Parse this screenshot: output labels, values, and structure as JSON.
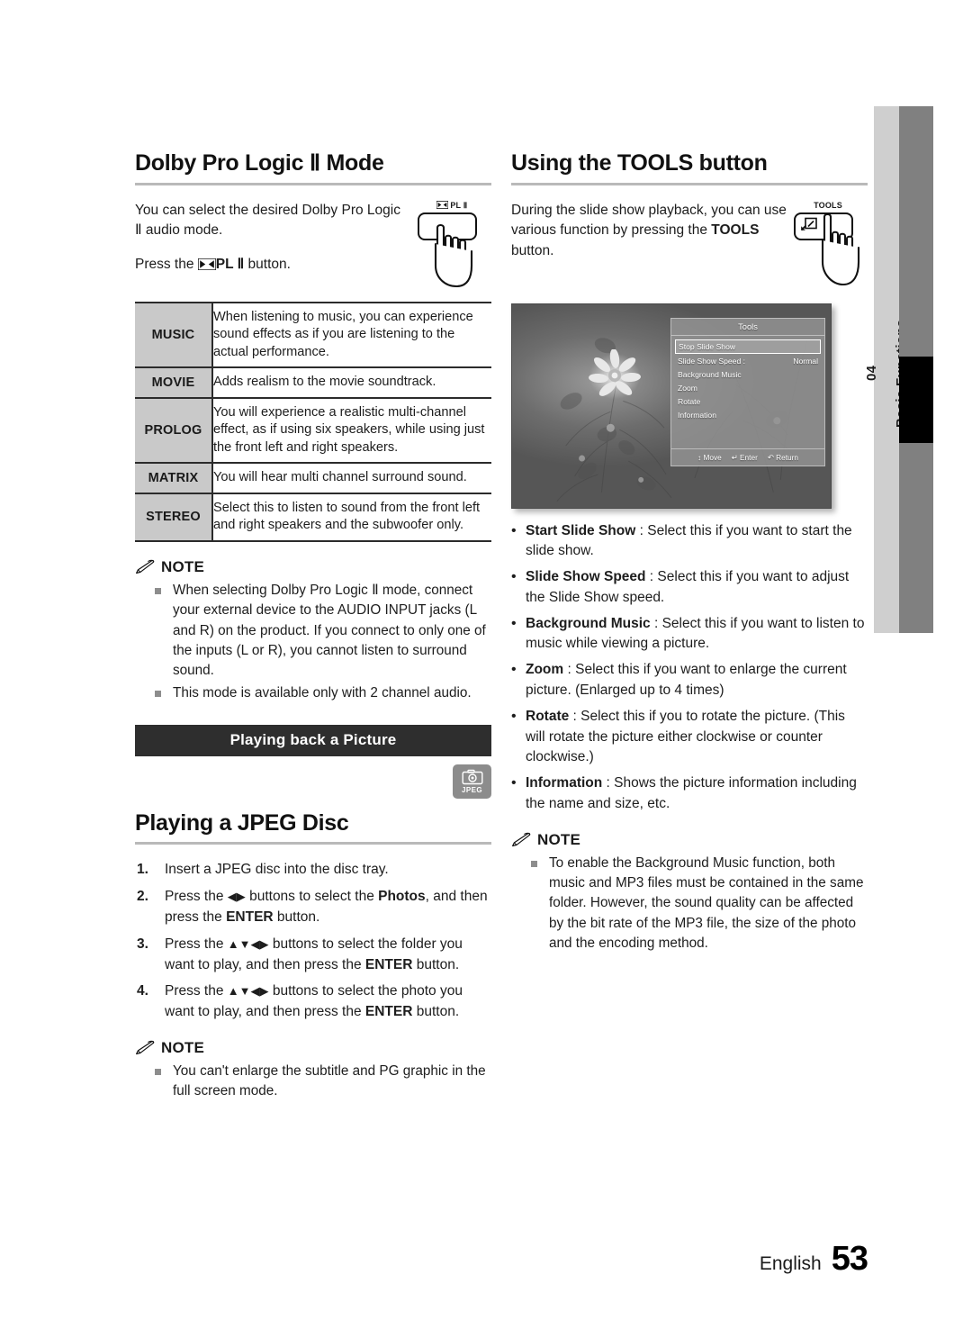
{
  "chapter_tab": {
    "number": "04",
    "name": "Basic Functions"
  },
  "footer": {
    "language": "English",
    "page": "53"
  },
  "left_column": {
    "section1": {
      "title": "Dolby Pro Logic Ⅱ Mode",
      "intro_line1": "You can select the desired Dolby Pro",
      "intro_line2": "Logic Ⅱ audio mode.",
      "press_prefix": "Press the ",
      "press_button": "PL Ⅱ",
      "press_suffix": " button.",
      "key_illustration": {
        "cap_label": "PL Ⅱ",
        "icon": "dolby-pro-logic-icon"
      },
      "table": {
        "rows": [
          {
            "mode": "MUSIC",
            "desc": "When listening to music, you can experience sound effects as if you are listening to the actual performance."
          },
          {
            "mode": "MOVIE",
            "desc": "Adds realism to the movie soundtrack."
          },
          {
            "mode": "PROLOG",
            "desc": "You will experience a realistic multi-channel effect, as if using six speakers, while using just the front left and right speakers."
          },
          {
            "mode": "MATRIX",
            "desc": "You will hear multi channel surround sound."
          },
          {
            "mode": "STEREO",
            "desc": "Select this to listen to sound from the front left and right speakers and the subwoofer only."
          }
        ]
      },
      "note": {
        "label": "NOTE",
        "items": [
          "When selecting Dolby Pro Logic Ⅱ mode, connect your external device to the AUDIO INPUT jacks (L and R) on the product. If you connect to only one of the inputs (L or R), you cannot listen to surround sound.",
          "This mode is available only with 2 channel audio."
        ]
      }
    },
    "banner": "Playing back a Picture",
    "media_badge": {
      "icon": "camera-icon",
      "label": "JPEG"
    },
    "section2": {
      "title": "Playing a JPEG Disc",
      "steps": [
        {
          "num": "1.",
          "parts": [
            {
              "t": "Insert a JPEG disc into the disc tray."
            }
          ]
        },
        {
          "num": "2.",
          "parts": [
            {
              "t": "Press the "
            },
            {
              "t": "◀▶",
              "s": "arrows"
            },
            {
              "t": " buttons to select the "
            },
            {
              "t": "Photos",
              "s": "b"
            },
            {
              "t": ", and then press the "
            },
            {
              "t": "ENTER",
              "s": "b"
            },
            {
              "t": " button."
            }
          ]
        },
        {
          "num": "3.",
          "parts": [
            {
              "t": "Press the "
            },
            {
              "t": "▲▼◀▶",
              "s": "arrows"
            },
            {
              "t": " buttons to select the folder you want to play, and then press the "
            },
            {
              "t": "ENTER",
              "s": "b"
            },
            {
              "t": " button."
            }
          ]
        },
        {
          "num": "4.",
          "parts": [
            {
              "t": "Press the "
            },
            {
              "t": "▲▼◀▶",
              "s": "arrows"
            },
            {
              "t": " buttons to select the photo you want to play, and then press the "
            },
            {
              "t": "ENTER",
              "s": "b"
            },
            {
              "t": " button."
            }
          ]
        }
      ],
      "note": {
        "label": "NOTE",
        "items": [
          "You can't enlarge the subtitle and PG graphic in the full screen mode."
        ]
      }
    }
  },
  "right_column": {
    "section1": {
      "title": "Using the TOOLS button",
      "intro_parts": [
        {
          "t": "During the slide show playback, you can use various function by pressing the "
        },
        {
          "t": "TOOLS",
          "s": "b"
        },
        {
          "t": " button."
        }
      ],
      "key_illustration": {
        "cap_label": "TOOLS",
        "icon": "tools-key-icon"
      }
    },
    "tv_screenshot": {
      "name": "tools-menu-screenshot",
      "panel_title": "Tools",
      "items": [
        {
          "label": "Stop Slide Show",
          "value": "",
          "selected": true
        },
        {
          "label": "Slide Show Speed :",
          "value": "Normal",
          "selected": false
        },
        {
          "label": "Background Music",
          "value": "",
          "selected": false
        },
        {
          "label": "Zoom",
          "value": "",
          "selected": false
        },
        {
          "label": "Rotate",
          "value": "",
          "selected": false
        },
        {
          "label": "Information",
          "value": "",
          "selected": false
        }
      ],
      "footer_hints": [
        {
          "icon": "↕",
          "label": "Move"
        },
        {
          "icon": "↵",
          "label": "Enter"
        },
        {
          "icon": "↶",
          "label": "Return"
        }
      ]
    },
    "bullets": [
      {
        "term": "Start Slide Show",
        "sep": " : ",
        "desc": "Select this if you want to start the slide show."
      },
      {
        "term": "Slide Show Speed",
        "sep": " : ",
        "desc": "Select this if you want to adjust the Slide Show speed."
      },
      {
        "term": "Background Music",
        "sep": " : ",
        "desc": "Select this if you want to listen to music while viewing a picture."
      },
      {
        "term": "Zoom",
        "sep": " : ",
        "desc": "Select this if you want to enlarge the current picture. (Enlarged up to 4 times)"
      },
      {
        "term": "Rotate",
        "sep": " : ",
        "desc": "Select this if you to rotate the picture. (This will rotate the picture either clockwise or counter clockwise.)"
      },
      {
        "term": "Information",
        "sep": " : ",
        "desc": "Shows the picture information including the name and size, etc."
      }
    ],
    "note": {
      "label": "NOTE",
      "items": [
        "To enable the Background Music function, both music and MP3 files must be contained in the same folder. However, the sound quality can be affected by the bit rate of the MP3 file, the size of the photo and the encoding method."
      ]
    }
  }
}
